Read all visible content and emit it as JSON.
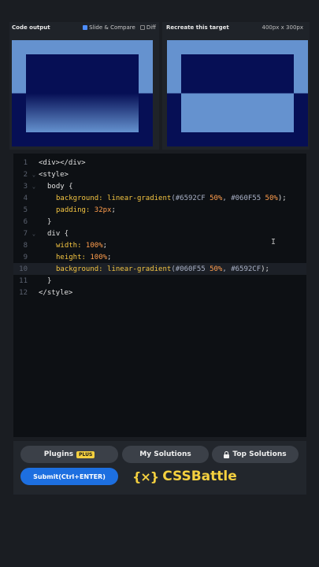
{
  "preview": {
    "code_output_label": "Code output",
    "slide_compare_label": "Slide & Compare",
    "diff_label": "Diff",
    "target_label": "Recreate this target",
    "size_label": "400px x 300px"
  },
  "editor": {
    "lines": [
      {
        "n": "1",
        "fold": ""
      },
      {
        "n": "2",
        "fold": "⌄"
      },
      {
        "n": "3",
        "fold": "⌄"
      },
      {
        "n": "4",
        "fold": ""
      },
      {
        "n": "5",
        "fold": ""
      },
      {
        "n": "6",
        "fold": ""
      },
      {
        "n": "7",
        "fold": "⌄"
      },
      {
        "n": "8",
        "fold": ""
      },
      {
        "n": "9",
        "fold": ""
      },
      {
        "n": "10",
        "fold": ""
      },
      {
        "n": "11",
        "fold": ""
      },
      {
        "n": "12",
        "fold": ""
      }
    ],
    "code": {
      "l1": "<div></div>",
      "l2": "<style>",
      "l3_sel": "body",
      "l3_brace": " {",
      "l4_prop": "background:",
      "l4_fn": " linear-gradient",
      "l4_a": "(#6592CF ",
      "l4_p1": "50%",
      "l4_b": ", #060F55 ",
      "l4_p2": "50%",
      "l4_c": ");",
      "l5_prop": "padding:",
      "l5_val": " 32px",
      "l5_end": ";",
      "l6": "}",
      "l7_sel": "div",
      "l7_brace": " {",
      "l8_prop": "width:",
      "l8_val": " 100%",
      "l8_end": ";",
      "l9_prop": "height:",
      "l9_val": " 100%",
      "l9_end": ";",
      "l10_prop": "background:",
      "l10_fn": " linear-gradient",
      "l10_a": "(#060F55 ",
      "l10_p1": "50%",
      "l10_b": ", #6592CF",
      "l10_c": ");",
      "l11": "}",
      "l12": "</style>"
    }
  },
  "actions": {
    "plugins_label": "Plugins",
    "plus_badge": "PLUS",
    "my_solutions_label": "My Solutions",
    "top_solutions_label": "Top Solutions",
    "submit_label": "Submit(Ctrl+ENTER)",
    "brand_name": "CSSBattle",
    "brand_icon": "{⨯}"
  },
  "colors": {
    "light_blue": "#6592CF",
    "dark_blue": "#060F55",
    "accent": "#f4d03f",
    "submit_blue": "#1d6fe0"
  }
}
